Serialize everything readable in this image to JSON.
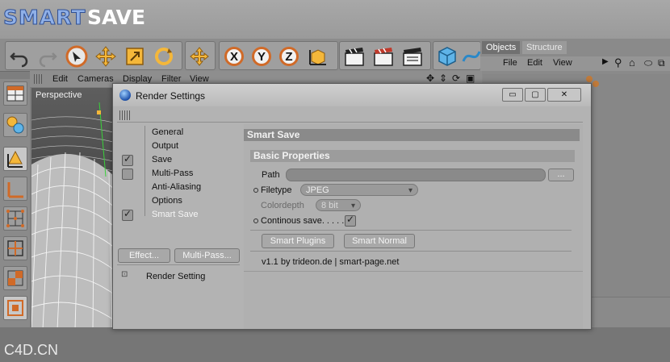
{
  "logo": {
    "smart": "SMART",
    "save": "SAVE"
  },
  "watermark": "C4D.CN",
  "objects_panel": {
    "tabs": [
      "Objects",
      "Structure"
    ],
    "menu": [
      "File",
      "Edit",
      "View"
    ]
  },
  "viewport": {
    "menu": [
      "Edit",
      "Cameras",
      "Display",
      "Filter",
      "View"
    ],
    "label": "Perspective"
  },
  "render_settings": {
    "title": "Render Settings",
    "window_buttons": {
      "minimize": "▭",
      "maximize": "▢",
      "close": "✕"
    },
    "nav": [
      {
        "label": "General",
        "checkbox": false,
        "checked": false
      },
      {
        "label": "Output",
        "checkbox": false,
        "checked": false
      },
      {
        "label": "Save",
        "checkbox": true,
        "checked": true
      },
      {
        "label": "Multi-Pass",
        "checkbox": true,
        "checked": false
      },
      {
        "label": "Anti-Aliasing",
        "checkbox": false,
        "checked": false
      },
      {
        "label": "Options",
        "checkbox": false,
        "checked": false
      },
      {
        "label": "Smart Save",
        "checkbox": true,
        "checked": true
      }
    ],
    "effect_button": "Effect...",
    "multipass_button": "Multi-Pass...",
    "render_setting_item": "Render Setting",
    "section_title": "Smart Save",
    "basic_properties": "Basic Properties",
    "path_label": "Path",
    "path_browse": "...",
    "filetype_label": "Filetype",
    "filetype_value": "JPEG",
    "colordepth_label": "Colordepth",
    "colordepth_value": "8 bit",
    "continuous_save_label": "Continous save. . . . .",
    "continuous_save_checked": true,
    "smart_plugins_button": "Smart Plugins",
    "smart_normal_button": "Smart Normal",
    "version_text": "v1.1 by trideon.de | smart-page.net"
  },
  "colors": {
    "accent_orange": "#d06a28",
    "logo_blue": "#8fb0e8",
    "header_bar": "#8c8c8c"
  }
}
